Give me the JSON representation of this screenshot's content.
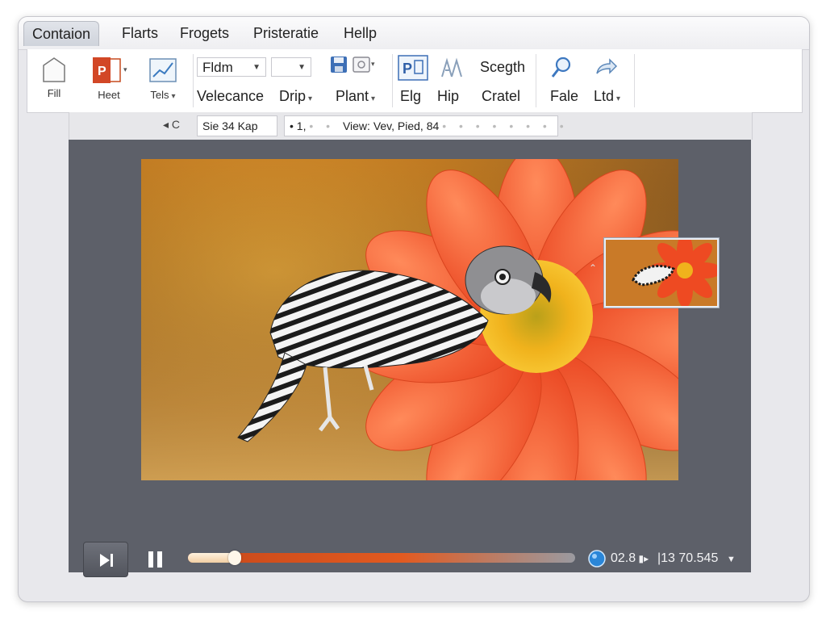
{
  "menubar": {
    "items": [
      {
        "label": "Contaion",
        "active": true
      },
      {
        "label": "Flarts"
      },
      {
        "label": "Frogets"
      },
      {
        "label": "Pristeratie"
      },
      {
        "label": "Hellp"
      }
    ]
  },
  "ribbon": {
    "fill_label": "Fill",
    "heet_label": "Heet",
    "tels_label": "Tels",
    "font_dropdown": "Fldm",
    "size_dropdown": "",
    "velecance_label": "Velecance",
    "drip_label": "Drip",
    "plant_label": "Plant",
    "elg_label": "Elg",
    "hip_label": "Hip",
    "scegth_label": "Scegth",
    "cratel_label": "Cratel",
    "fale_label": "Fale",
    "ltd_label": "Ltd"
  },
  "addressbar": {
    "nav": "◂ C",
    "size_field": "Sie 34 Kap",
    "view_field_left": "• 1,",
    "view_field_text": "View: Vev, Pied, 84"
  },
  "player": {
    "time_left": "02.8",
    "time_right": "|13 70.545",
    "progress": 0.12
  },
  "colors": {
    "accent": "#e25a20",
    "viewer_bg": "#5d6069",
    "flower": "#f2552a"
  }
}
